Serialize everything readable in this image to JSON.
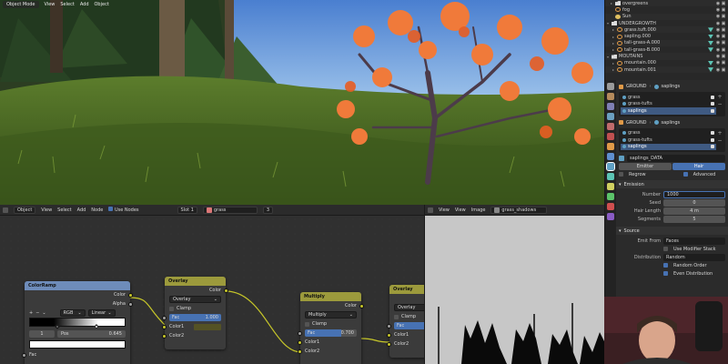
{
  "viewport": {
    "mode_label": "Object Mode",
    "menu": [
      "View",
      "Select",
      "Add",
      "Object"
    ]
  },
  "node_editor": {
    "header": {
      "type": "Object",
      "menu": [
        "View",
        "Select",
        "Add",
        "Node"
      ],
      "use_nodes": "Use Nodes",
      "slot": "Slot 1",
      "material": "grass",
      "users": "3"
    },
    "colorramp": {
      "title": "ColorRamp",
      "out_color": "Color",
      "out_alpha": "Alpha",
      "mode": "RGB",
      "interp": "Linear",
      "index": "1",
      "pos_label": "Pos",
      "pos_value": "0.645",
      "fac": "Fac"
    },
    "overlay1": {
      "title": "Overlay",
      "out": "Color",
      "blend": "Overlay",
      "clamp": "Clamp",
      "fac_label": "Fac",
      "fac_value": "1.000",
      "color1": "Color1",
      "color2": "Color2"
    },
    "multiply": {
      "title": "Multiply",
      "out": "Color",
      "blend": "Multiply",
      "clamp": "Clamp",
      "fac_label": "Fac",
      "fac_value": "0.700",
      "color1": "Color1",
      "color2": "Color2"
    },
    "overlay2": {
      "title": "Overlay",
      "blend": "Overlay",
      "clamp": "Clamp",
      "fac_label": "Fac",
      "color1": "Color1",
      "color2": "Color2"
    }
  },
  "image_editor": {
    "menu": [
      "View",
      "View",
      "Image"
    ],
    "image_name": "grass_shadows"
  },
  "outliner": {
    "rows": [
      {
        "label": "overgreens",
        "icon": "collection-icon",
        "indent": 1
      },
      {
        "label": "fog",
        "icon": "object-icon",
        "indent": 1
      },
      {
        "label": "Sun",
        "icon": "light-icon",
        "indent": 1
      },
      {
        "label": "UNDERGROWTH",
        "icon": "collection-icon",
        "indent": 0
      },
      {
        "label": "grass.tuft.000",
        "icon": "object-icon",
        "indent": 1
      },
      {
        "label": "sapling.000",
        "icon": "object-icon",
        "indent": 1
      },
      {
        "label": "tall-grass-A.000",
        "icon": "object-icon",
        "indent": 1
      },
      {
        "label": "tall-grass-B.000",
        "icon": "object-icon",
        "indent": 1
      },
      {
        "label": "MOUTAINS",
        "icon": "collection-icon",
        "indent": 0
      },
      {
        "label": "mountain.000",
        "icon": "object-icon",
        "indent": 1
      },
      {
        "label": "mountain.001",
        "icon": "object-icon",
        "indent": 1
      }
    ]
  },
  "properties": {
    "ctx1": {
      "object": "GROUND",
      "system": "saplings"
    },
    "list1": [
      "grass",
      "grass-tufts",
      "saplings"
    ],
    "ctx2": {
      "object": "GROUND",
      "system": "saplings"
    },
    "list2": [
      "grass",
      "grass-tufts",
      "saplings"
    ],
    "settings_name": "saplings_DATA",
    "type_emitter": "Emitter",
    "type_hair": "Hair",
    "regrow": "Regrow",
    "advanced": "Advanced",
    "emission": {
      "title": "Emission",
      "number_label": "Number",
      "number_value": "1000",
      "seed_label": "Seed",
      "seed_value": "0",
      "hair_length_label": "Hair Length",
      "hair_length_value": "4 m",
      "segments_label": "Segments",
      "segments_value": "5"
    },
    "source": {
      "title": "Source",
      "emit_from_label": "Emit From",
      "emit_from_value": "Faces",
      "use_modifier_stack": "Use Modifier Stack",
      "distribution_label": "Distribution",
      "distribution_value": "Random",
      "random_order": "Random Order",
      "even_distribution": "Even Distribution"
    }
  }
}
